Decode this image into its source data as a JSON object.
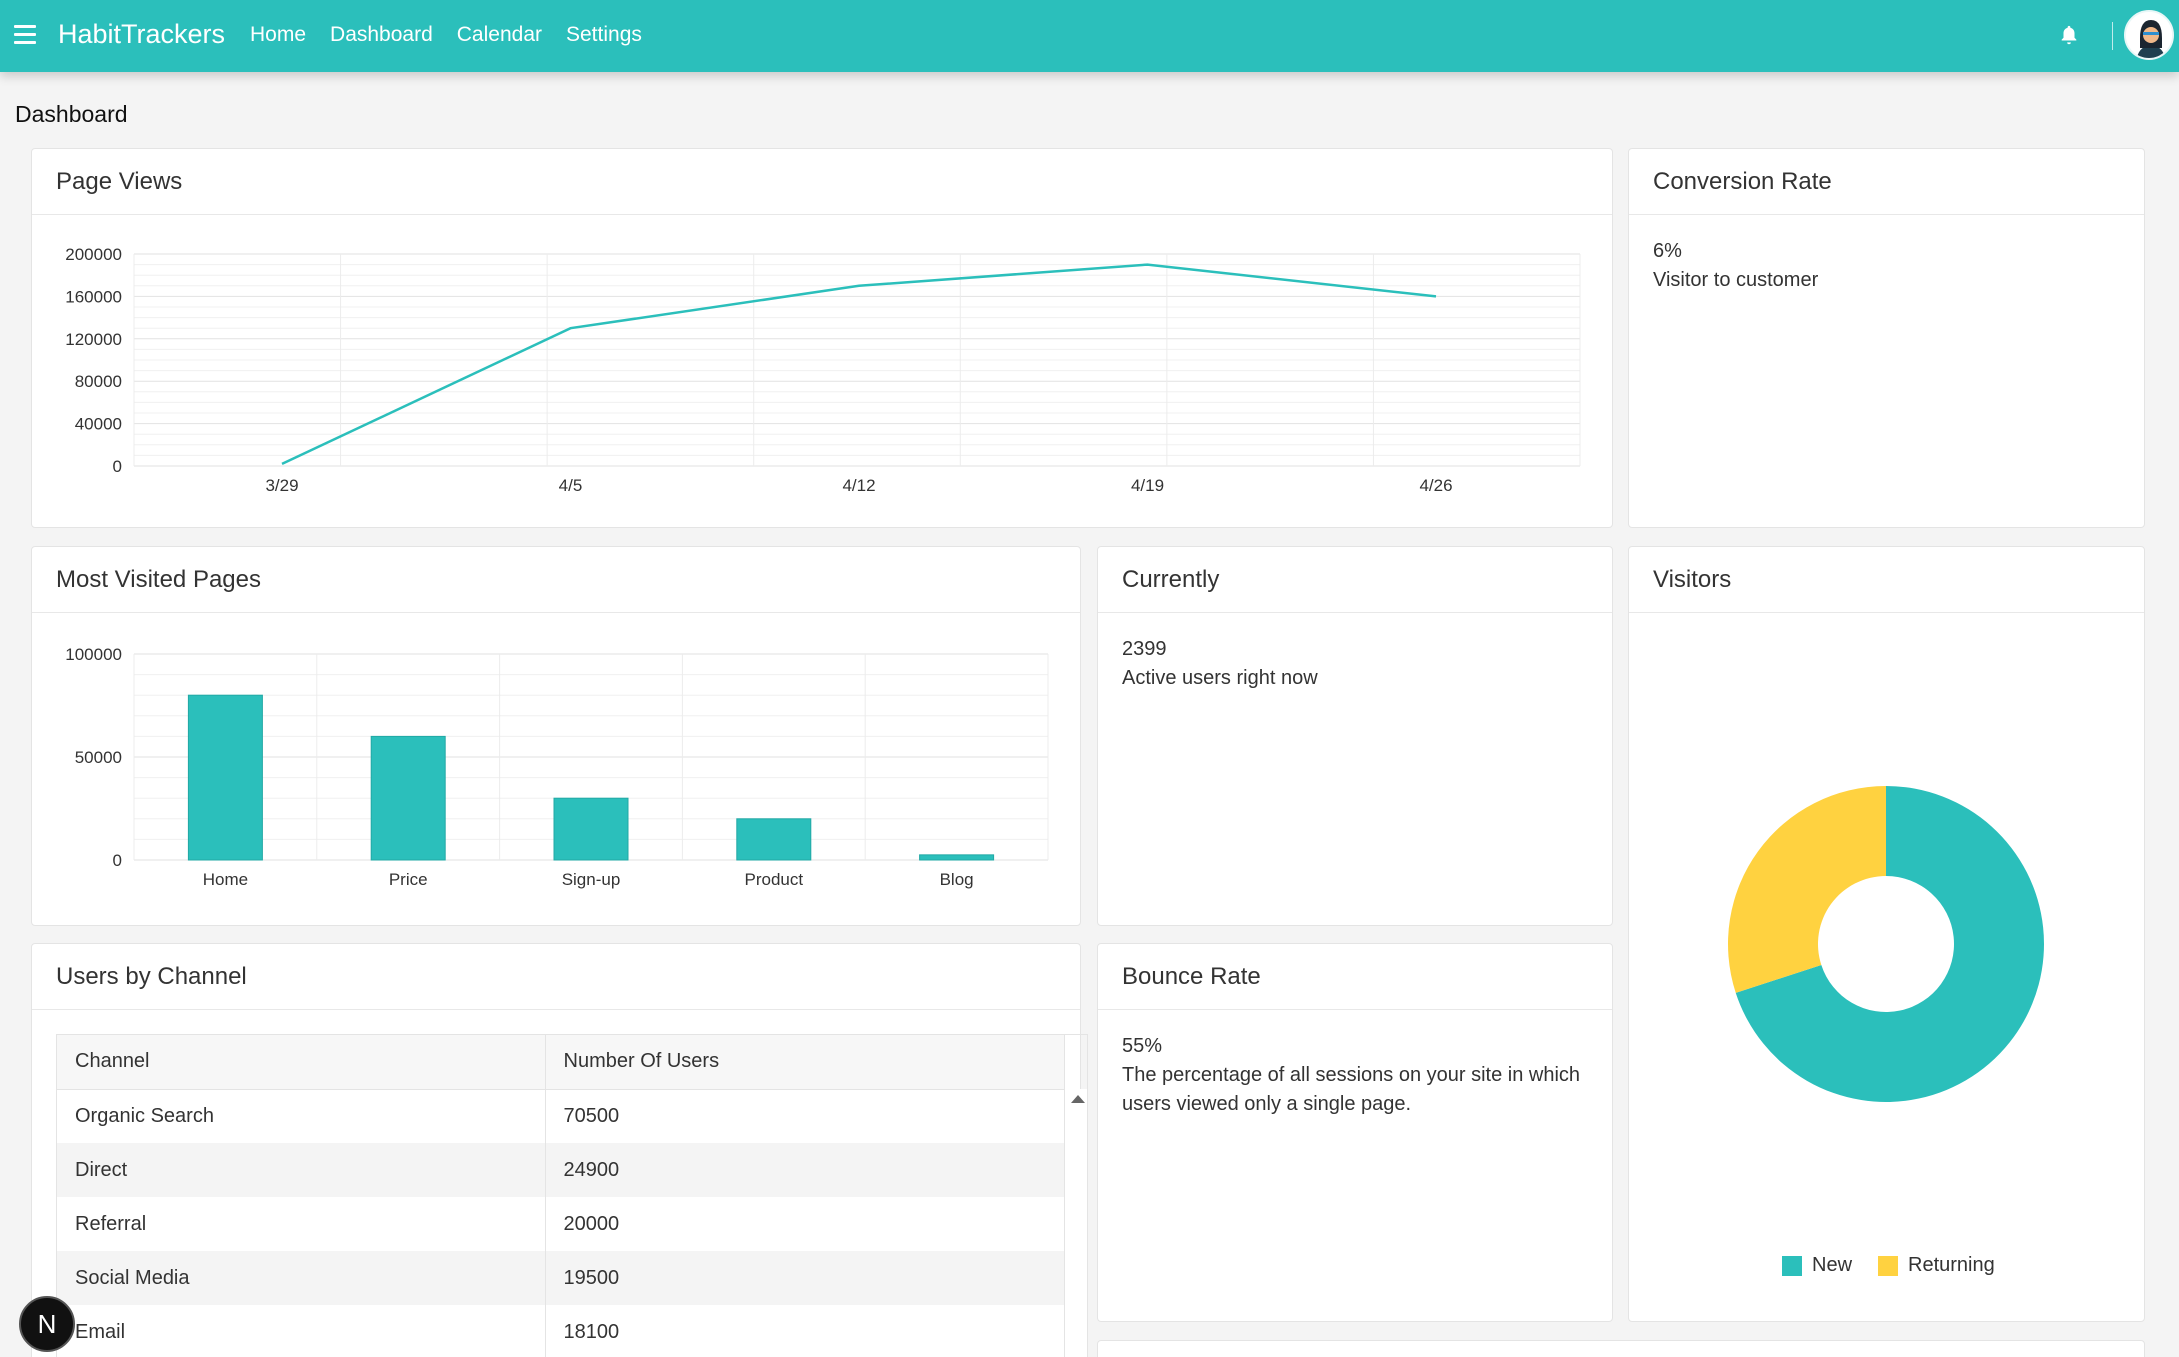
{
  "app": {
    "brand": "HabitTrackers",
    "nav": [
      "Home",
      "Dashboard",
      "Calendar",
      "Settings"
    ],
    "page_title": "Dashboard",
    "dev_badge": "N"
  },
  "colors": {
    "accent": "#2bbfbb",
    "secondary": "#ffd240"
  },
  "cards": {
    "page_views": {
      "title": "Page Views",
      "chart_data": {
        "type": "line",
        "x": [
          "3/29",
          "4/5",
          "4/12",
          "4/19",
          "4/26"
        ],
        "values": [
          2000,
          130000,
          170000,
          190000,
          160000
        ],
        "ylim": [
          0,
          200000
        ],
        "yticks": [
          "0",
          "40000",
          "80000",
          "120000",
          "160000",
          "200000"
        ],
        "grid": true,
        "color": "#2bbfbb"
      }
    },
    "conversion": {
      "title": "Conversion Rate",
      "value": "6%",
      "label": "Visitor to customer"
    },
    "most_visited": {
      "title": "Most Visited Pages",
      "chart_data": {
        "type": "bar",
        "categories": [
          "Home",
          "Price",
          "Sign-up",
          "Product",
          "Blog"
        ],
        "values": [
          80000,
          60000,
          30000,
          20000,
          2500
        ],
        "ylim": [
          0,
          100000
        ],
        "yticks": [
          "0",
          "50000",
          "100000"
        ],
        "grid": true,
        "color": "#2bbfbb"
      }
    },
    "currently": {
      "title": "Currently",
      "value": "2399",
      "label": "Active users right now"
    },
    "visitors": {
      "title": "Visitors",
      "chart_data": {
        "type": "pie",
        "style": "donut",
        "series": [
          {
            "name": "New",
            "value": 70,
            "color": "#2bbfbb"
          },
          {
            "name": "Returning",
            "value": 30,
            "color": "#ffd240"
          }
        ],
        "legend": "bottom"
      }
    },
    "users_by_channel": {
      "title": "Users by Channel",
      "columns": [
        "Channel",
        "Number Of Users"
      ],
      "rows": [
        [
          "Organic Search",
          "70500"
        ],
        [
          "Direct",
          "24900"
        ],
        [
          "Referral",
          "20000"
        ],
        [
          "Social Media",
          "19500"
        ],
        [
          "Email",
          "18100"
        ]
      ]
    },
    "bounce": {
      "title": "Bounce Rate",
      "value": "55%",
      "label": "The percentage of all sessions on your site in which users viewed only a single page."
    }
  }
}
